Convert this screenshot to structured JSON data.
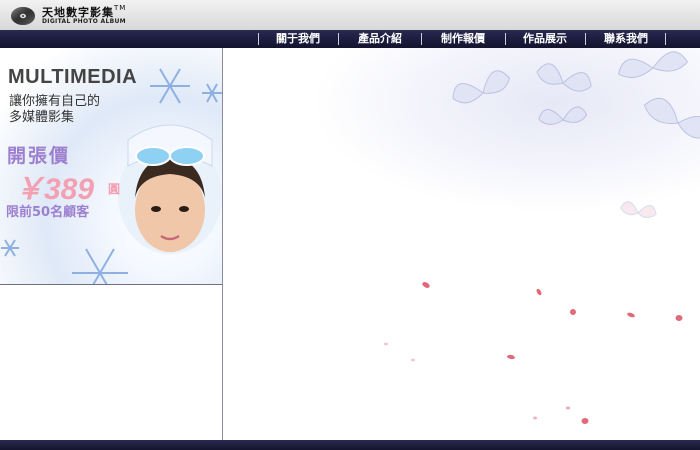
{
  "header": {
    "brand_cn": "天地數字影集",
    "brand_tm": "TM",
    "brand_en": "DIGITAL PHOTO ALBUM",
    "logo_icon": "cd-disc-icon"
  },
  "nav": {
    "items": [
      {
        "label": "關于我們"
      },
      {
        "label": "產品介紹"
      },
      {
        "label": "制作報價"
      },
      {
        "label": "作品展示"
      },
      {
        "label": "聯系我們"
      }
    ]
  },
  "promo": {
    "title": "MULTIMEDIA",
    "line1": "讓你擁有自己的",
    "line2": "多媒體影集",
    "opening_label": "開張價",
    "price": "￥389",
    "price_unit": "圓",
    "limit_text": "限前50名顧客",
    "accent_color": "#9d7fd0",
    "price_color": "#f3a0b2"
  },
  "theme": {
    "nav_bg": "#1a1a3c",
    "header_bg": "#e4e4e4"
  }
}
